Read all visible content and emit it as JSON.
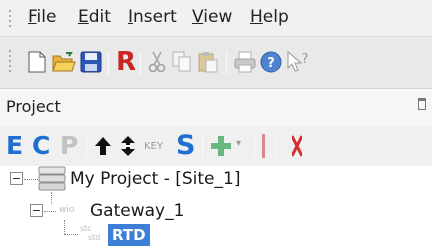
{
  "menu": {
    "items": [
      "File",
      "Edit",
      "Insert",
      "View",
      "Help"
    ]
  },
  "toolbar": {
    "icons": [
      "new-file-icon",
      "open-folder-icon",
      "save-icon",
      "r-command-icon",
      "cut-icon",
      "copy-icon",
      "paste-icon",
      "print-icon",
      "help-icon",
      "context-help-icon"
    ],
    "r_label": "R"
  },
  "panel": {
    "title": "Project",
    "toolbar": {
      "e_label": "E",
      "c_label": "C",
      "p_label": "P",
      "key_label": "KEY",
      "s_label": "S"
    }
  },
  "tree": {
    "project_label": "My Project - [Site_1]",
    "gateway_prefix": "wio",
    "gateway_label": "Gateway_1",
    "rtd_prefix_top": "stc",
    "rtd_prefix_bottom": "std",
    "rtd_label": "RTD"
  },
  "colors": {
    "accent_blue": "#1f6fd1",
    "selection": "#3c7fd6",
    "save_red": "#c62828",
    "plus_green": "#3aa55a"
  }
}
